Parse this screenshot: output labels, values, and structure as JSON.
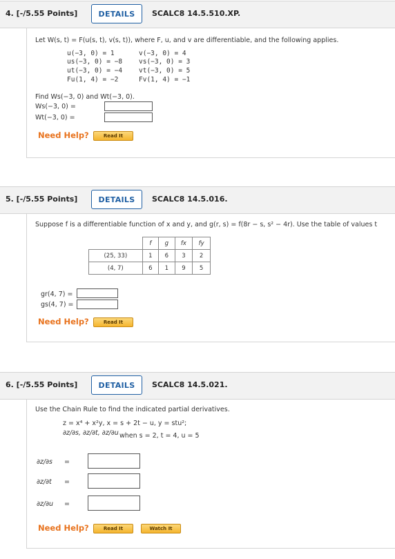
{
  "q4": {
    "title": "4. [-/5.55 Points]",
    "details": "DETAILS",
    "code": "SCALC8 14.5.510.XP.",
    "prompt": "Let W(s, t) = F(u(s, t), v(s, t)), where F, u, and v are differentiable, and the following applies.",
    "left": [
      "u(−3, 0) = 1",
      "us(−3, 0) = −8",
      "ut(−3, 0) = −4",
      "Fu(1, 4) = −2"
    ],
    "right": [
      "v(−3, 0) = 4",
      "vs(−3, 0) = 3",
      "vt(−3, 0) = 5",
      "Fv(1, 4) = −1"
    ],
    "find": "Find Ws(−3, 0) and Wt(−3, 0).",
    "a1": "Ws(−3, 0) =",
    "a2": "Wt(−3, 0) =",
    "need_help": "Need Help?",
    "read_it": "Read It"
  },
  "q5": {
    "title": "5. [-/5.55 Points]",
    "details": "DETAILS",
    "code": "SCALC8 14.5.016.",
    "prompt": "Suppose f is a differentiable function of x and y, and g(r, s) = f(8r − s, s² − 4r). Use the table of values t",
    "table": {
      "headers": [
        "",
        "f",
        "g",
        "fx",
        "fy"
      ],
      "rows": [
        [
          "(25, 33)",
          "1",
          "6",
          "3",
          "2"
        ],
        [
          "(4, 7)",
          "6",
          "1",
          "9",
          "5"
        ]
      ]
    },
    "a1": "gr(4, 7) =",
    "a2": "gs(4, 7) =",
    "need_help": "Need Help?",
    "read_it": "Read It"
  },
  "q6": {
    "title": "6. [-/5.55 Points]",
    "details": "DETAILS",
    "code": "SCALC8 14.5.021.",
    "prompt": "Use the Chain Rule to find the indicated partial derivatives.",
    "eq": "z = x⁴ + x²y,   x = s + 2t − u,   y = stu²;",
    "when": "when s = 2, t = 4, u = 5",
    "partials": [
      "∂z/∂s",
      "∂z/∂t",
      "∂z/∂u"
    ],
    "need_help": "Need Help?",
    "read_it": "Read It",
    "watch_it": "Watch It"
  },
  "colors": {
    "accent": "#1f5fa3",
    "need_help": "#e8731e",
    "header_bg": "#f2f2f2"
  }
}
